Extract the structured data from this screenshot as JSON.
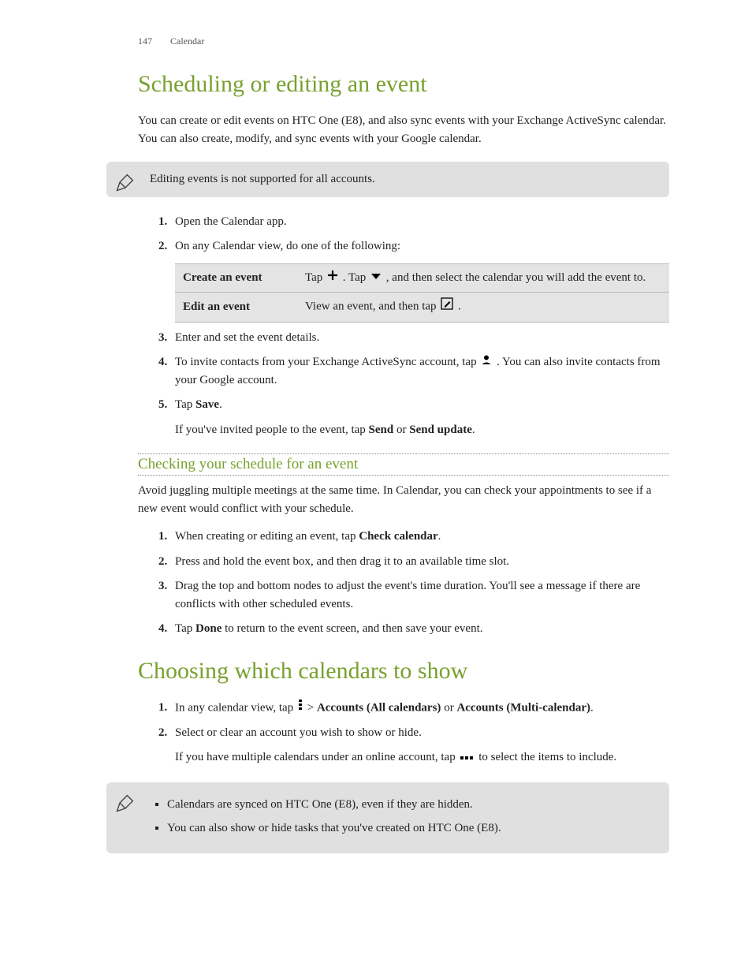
{
  "header": {
    "page_number": "147",
    "section": "Calendar"
  },
  "h1_a": "Scheduling or editing an event",
  "intro_a": "You can create or edit events on HTC One (E8), and also sync events with your Exchange ActiveSync calendar. You can also create, modify, and sync events with your Google calendar.",
  "note_a": "Editing events is not supported for all accounts.",
  "steps_a": {
    "s1": "Open the Calendar app.",
    "s2": "On any Calendar view, do one of the following:",
    "table": {
      "r1_label": "Create an event",
      "r1_a": "Tap ",
      "r1_b": ". Tap ",
      "r1_c": " , and then select the calendar you will add the event to.",
      "r2_label": "Edit an event",
      "r2_a": "View an event, and then tap ",
      "r2_b": "."
    },
    "s3": "Enter and set the event details.",
    "s4_a": "To invite contacts from your Exchange ActiveSync account, tap ",
    "s4_b": ". You can also invite contacts from your Google account.",
    "s5_a": "Tap ",
    "s5_bold": "Save",
    "s5_b": ".",
    "s5_sub_a": "If you've invited people to the event, tap ",
    "s5_sub_bold1": "Send",
    "s5_sub_mid": " or ",
    "s5_sub_bold2": "Send update",
    "s5_sub_end": "."
  },
  "h2_a": "Checking your schedule for an event",
  "intro_b": "Avoid juggling multiple meetings at the same time. In Calendar, you can check your appointments to see if a new event would conflict with your schedule.",
  "steps_b": {
    "s1_a": "When creating or editing an event, tap ",
    "s1_bold": "Check calendar",
    "s1_b": ".",
    "s2": "Press and hold the event box, and then drag it to an available time slot.",
    "s3": "Drag the top and bottom nodes to adjust the event's time duration. You'll see a message if there are conflicts with other scheduled events.",
    "s4_a": "Tap ",
    "s4_bold": "Done",
    "s4_b": " to return to the event screen, and then save your event."
  },
  "h1_b": "Choosing which calendars to show",
  "steps_c": {
    "s1_a": "In any calendar view, tap ",
    "s1_gt": " > ",
    "s1_bold1": "Accounts (All calendars)",
    "s1_mid": " or ",
    "s1_bold2": "Accounts (Multi-calendar)",
    "s1_b": ".",
    "s2": "Select or clear an account you wish to show or hide.",
    "s2_sub_a": "If you have multiple calendars under an online account, tap ",
    "s2_sub_b": " to select the items to include."
  },
  "note_b": {
    "li1": "Calendars are synced on HTC One (E8), even if they are hidden.",
    "li2": "You can also show or hide tasks that you've created on HTC One (E8)."
  }
}
